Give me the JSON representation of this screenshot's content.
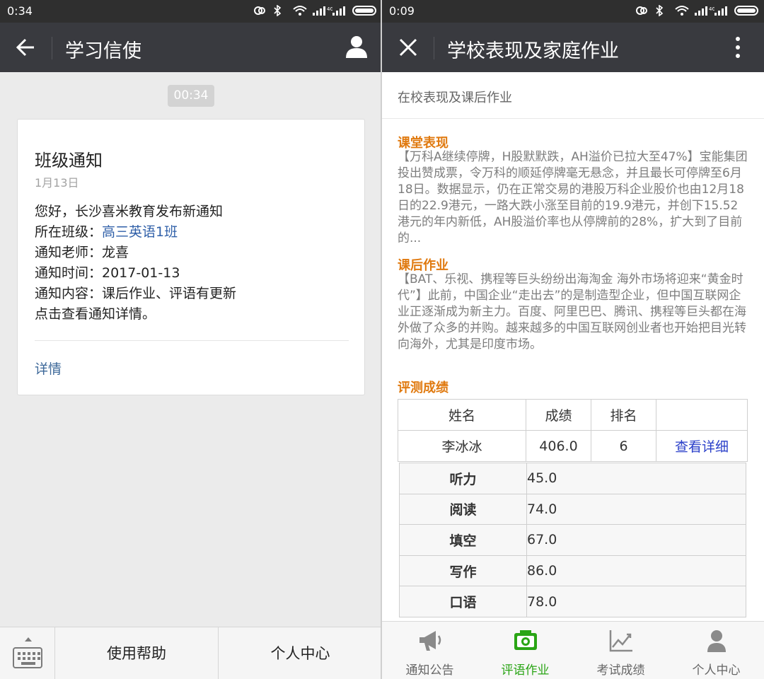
{
  "left": {
    "status": {
      "time": "0:34"
    },
    "header": {
      "title": "学习信使"
    },
    "time_chip": "00:34",
    "card": {
      "title": "班级通知",
      "date": "1月13日",
      "lines": {
        "l1": "您好，长沙喜米教育发布新通知",
        "l2_label": "所在班级：",
        "l2_link": "高三英语1班",
        "l3": "通知老师：龙喜",
        "l4": "通知时间：2017-01-13",
        "l5": "通知内容：课后作业、评语有更新",
        "l6": "点击查看通知详情。"
      },
      "detail_link": "详情"
    },
    "bottom": {
      "help": "使用帮助",
      "personal": "个人中心"
    }
  },
  "right": {
    "status": {
      "time": "0:09"
    },
    "header": {
      "title": "学校表现及家庭作业"
    },
    "subtitle": "在校表现及课后作业",
    "sections": {
      "classroom": {
        "title": "课堂表现",
        "body": "【万科A继续停牌，H股默默跌，AH溢价已拉大至47%】宝能集团投出赞成票，令万科的顺延停牌毫无悬念，并且最长可停牌至6月18日。数据显示，仍在正常交易的港股万科企业股价也由12月18日的22.9港元，一路大跌小涨至目前的19.9港元，并创下15.52港元的年内新低，AH股溢价率也从停牌前的28%，扩大到了目前的..."
      },
      "homework": {
        "title": "课后作业",
        "body": "【BAT、乐视、携程等巨头纷纷出海淘金 海外市场将迎来“黄金时代”】此前，中国企业“走出去”的是制造型企业，但中国互联网企业正逐渐成为新主力。百度、阿里巴巴、腾讯、携程等巨头都在海外做了众多的并购。越来越多的中国互联网创业者也开始把目光转向海外，尤其是印度市场。"
      },
      "scores": {
        "title": "评测成绩",
        "headers": {
          "name": "姓名",
          "score": "成绩",
          "rank": "排名"
        },
        "row": {
          "name": "李冰冰",
          "score": "406.0",
          "rank": "6",
          "link": "查看详细"
        },
        "subjects": [
          {
            "name": "听力",
            "score": "45.0"
          },
          {
            "name": "阅读",
            "score": "74.0"
          },
          {
            "name": "填空",
            "score": "67.0"
          },
          {
            "name": "写作",
            "score": "86.0"
          },
          {
            "name": "口语",
            "score": "78.0"
          }
        ]
      }
    },
    "tabs": [
      {
        "label": "通知公告",
        "icon": "megaphone-icon"
      },
      {
        "label": "评语作业",
        "icon": "camera-icon"
      },
      {
        "label": "考试成绩",
        "icon": "chart-icon"
      },
      {
        "label": "个人中心",
        "icon": "person-icon"
      }
    ],
    "colors": {
      "accent_green": "#2aa515",
      "section_orange": "#e07a10",
      "link_blue": "#2a3fc9"
    }
  }
}
